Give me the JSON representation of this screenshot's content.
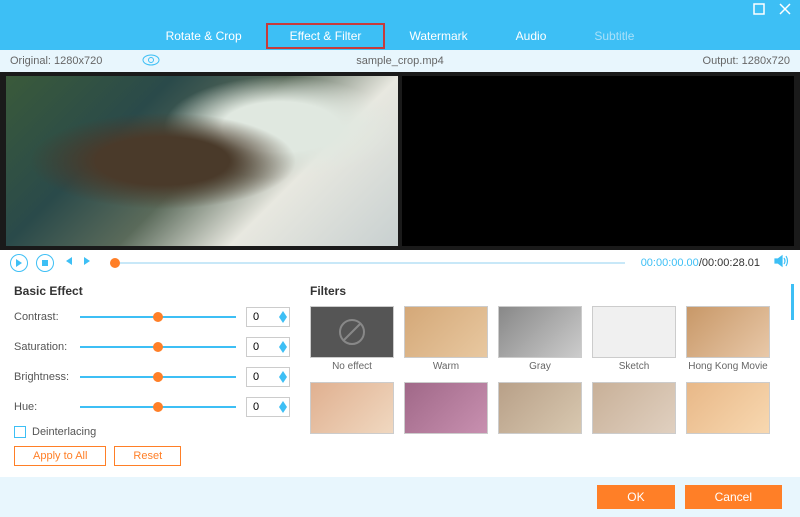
{
  "window": {
    "maximize": "maximize",
    "close": "close"
  },
  "tabs": {
    "rotate": "Rotate & Crop",
    "effect": "Effect & Filter",
    "watermark": "Watermark",
    "audio": "Audio",
    "subtitle": "Subtitle"
  },
  "info": {
    "original_label": "Original: 1280x720",
    "filename": "sample_crop.mp4",
    "output_label": "Output: 1280x720"
  },
  "playback": {
    "current": "00:00:00.00",
    "sep": "/",
    "total": "00:00:28.01"
  },
  "basic": {
    "title": "Basic Effect",
    "contrast": {
      "label": "Contrast:",
      "value": "0"
    },
    "saturation": {
      "label": "Saturation:",
      "value": "0"
    },
    "brightness": {
      "label": "Brightness:",
      "value": "0"
    },
    "hue": {
      "label": "Hue:",
      "value": "0"
    },
    "deinterlacing": "Deinterlacing",
    "apply_all": "Apply to All",
    "reset": "Reset"
  },
  "filters": {
    "title": "Filters",
    "items": {
      "none": "No effect",
      "warm": "Warm",
      "gray": "Gray",
      "sketch": "Sketch",
      "hk": "Hong Kong Movie"
    }
  },
  "footer": {
    "ok": "OK",
    "cancel": "Cancel"
  }
}
